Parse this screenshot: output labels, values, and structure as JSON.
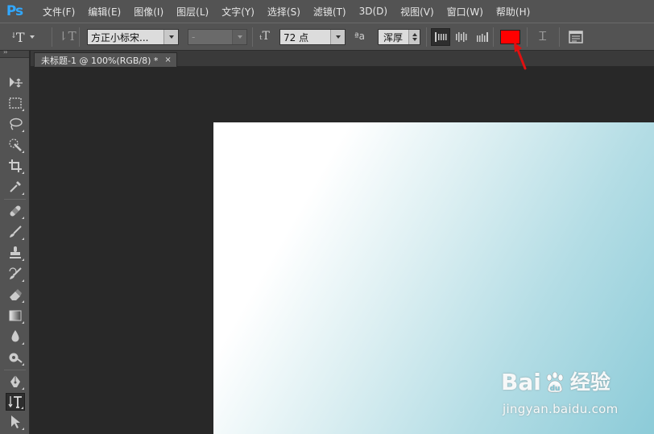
{
  "app": {
    "logo": "Ps"
  },
  "menu": [
    "文件(F)",
    "编辑(E)",
    "图像(I)",
    "图层(L)",
    "文字(Y)",
    "选择(S)",
    "滤镜(T)",
    "3D(D)",
    "视图(V)",
    "窗口(W)",
    "帮助(H)"
  ],
  "options": {
    "font_family": "方正小标宋...",
    "font_style": "-",
    "font_size": "72 点",
    "antialias": "浑厚",
    "text_color": "#ff0000"
  },
  "document": {
    "tab_title": "未标题-1 @ 100%(RGB/8) *",
    "close": "×"
  },
  "tools": [
    "move-tool",
    "marquee-tool",
    "lasso-tool",
    "quick-select-tool",
    "crop-tool",
    "eyedropper-tool",
    "healing-brush-tool",
    "brush-tool",
    "clone-stamp-tool",
    "history-brush-tool",
    "eraser-tool",
    "gradient-tool",
    "blur-tool",
    "dodge-tool",
    "pen-tool",
    "type-tool",
    "path-select-tool"
  ],
  "watermark": {
    "brand_left": "Bai",
    "brand_right": "经验",
    "url": "jingyan.baidu.com"
  }
}
